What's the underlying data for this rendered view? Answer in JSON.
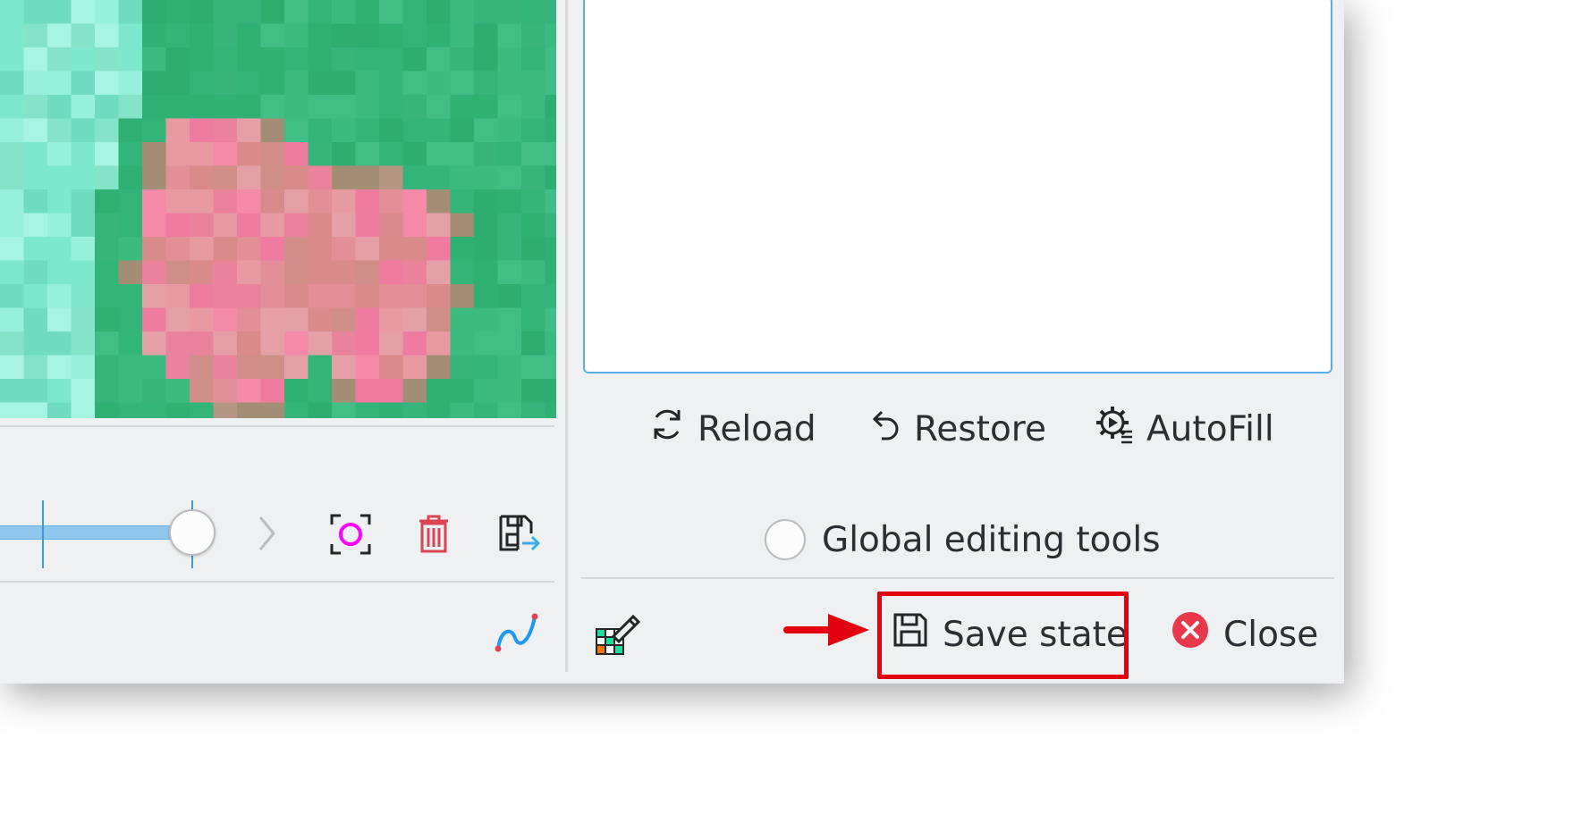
{
  "buttons": {
    "reload": "Reload",
    "restore": "Restore",
    "autofill": "AutoFill",
    "save_state": "Save state",
    "close": "Close"
  },
  "global_editing_tools": {
    "label": "Global editing tools",
    "checked": false
  },
  "icons": {
    "preview_toggle": "focus-circle-icon",
    "delete": "trash-icon",
    "save_export": "save-export-icon",
    "curve": "curve-icon",
    "grid_edit": "grid-edit-icon"
  },
  "colors": {
    "accent": "#3daee9",
    "highlight_red": "#e3000f",
    "close_red": "#e9374c",
    "image_green": "#38b77a",
    "image_pink": "#e9829a"
  }
}
